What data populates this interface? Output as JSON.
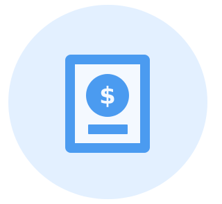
{
  "icon": {
    "name": "invoice-dollar-icon",
    "currency_symbol": "$"
  },
  "colors": {
    "background": "#ffffff",
    "circle": "#e3f0ff",
    "accent": "#4b9bf0",
    "paper": "#f4f9ff"
  }
}
